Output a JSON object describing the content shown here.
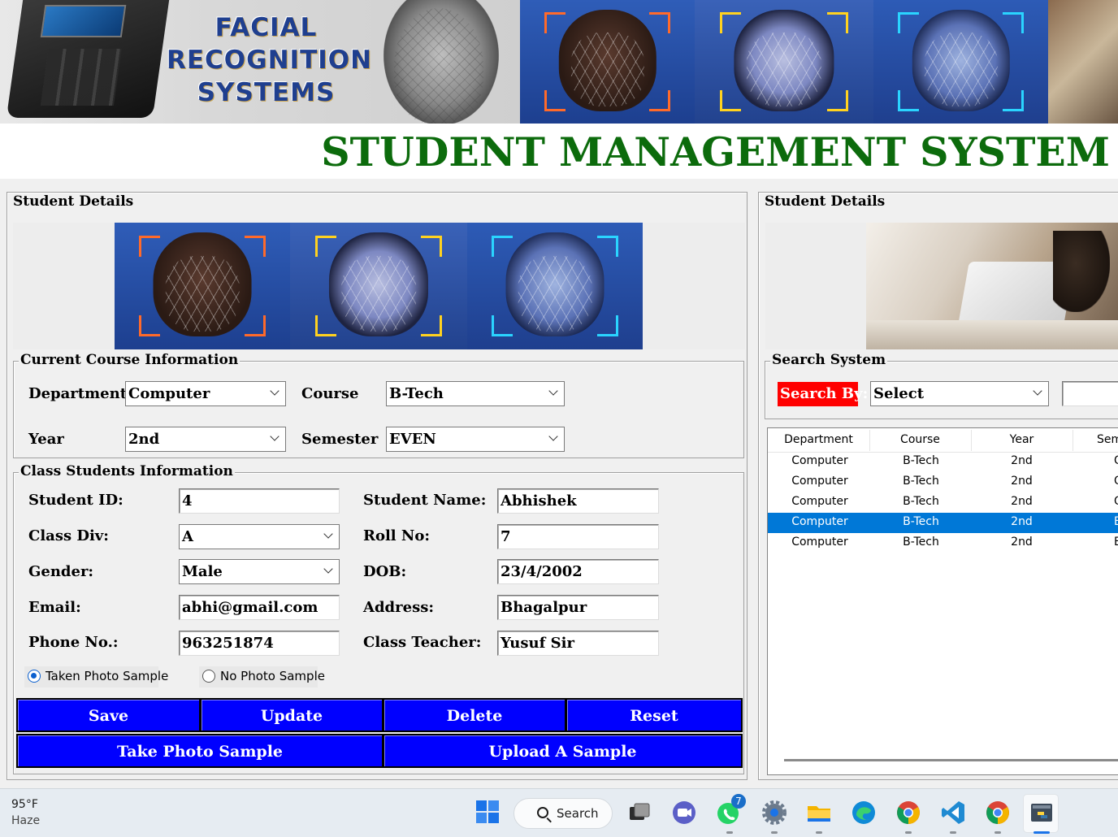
{
  "banner": {
    "text_lines": [
      "FACIAL",
      "RECOGNITION",
      "SYSTEMS"
    ],
    "title": "STUDENT MANAGEMENT SYSTEM",
    "title_color": "#0c6b0c"
  },
  "left_panel": {
    "legend": "Student Details",
    "course_frame": {
      "legend": "Current Course Information",
      "department_label": "Department",
      "department_value": "Computer",
      "course_label": "Course",
      "course_value": "B-Tech",
      "year_label": "Year",
      "year_value": "2nd",
      "semester_label": "Semester",
      "semester_value": "EVEN"
    },
    "class_frame": {
      "legend": "Class Students Information",
      "student_id_label": "Student ID:",
      "student_id_value": "4",
      "student_name_label": "Student Name:",
      "student_name_value": "Abhishek",
      "class_div_label": "Class Div:",
      "class_div_value": "A",
      "roll_no_label": "Roll No:",
      "roll_no_value": "7",
      "gender_label": "Gender:",
      "gender_value": "Male",
      "dob_label": "DOB:",
      "dob_value": "23/4/2002",
      "email_label": "Email:",
      "email_value": "abhi@gmail.com",
      "address_label": "Address:",
      "address_value": "Bhagalpur",
      "phone_label": "Phone No.:",
      "phone_value": "963251874",
      "teacher_label": "Class Teacher:",
      "teacher_value": "Yusuf Sir",
      "radio_taken": "Taken Photo Sample",
      "radio_none": "No Photo Sample",
      "radio_selected": "Taken Photo Sample"
    },
    "buttons": {
      "save": "Save",
      "update": "Update",
      "delete": "Delete",
      "reset": "Reset",
      "take_photo": "Take Photo Sample",
      "upload": "Upload A Sample",
      "color": "#0000ff"
    }
  },
  "right_panel": {
    "legend": "Student Details",
    "search_frame": {
      "legend": "Search System",
      "search_by_label": "Search By:",
      "search_by_value": "Select",
      "label_color": "#ff0000"
    },
    "table": {
      "columns": [
        "Department",
        "Course",
        "Year",
        "Sem"
      ],
      "rows": [
        [
          "Computer",
          "B-Tech",
          "2nd",
          "O"
        ],
        [
          "Computer",
          "B-Tech",
          "2nd",
          "O"
        ],
        [
          "Computer",
          "B-Tech",
          "2nd",
          "O"
        ],
        [
          "Computer",
          "B-Tech",
          "2nd",
          "E"
        ],
        [
          "Computer",
          "B-Tech",
          "2nd",
          "E"
        ]
      ],
      "selected_row": 3,
      "selection_color": "#0078d7"
    }
  },
  "taskbar": {
    "temperature": "95°F",
    "condition": "Haze",
    "search_label": "Search",
    "whatsapp_badge": "7",
    "icons": [
      "windows-start-icon",
      "task-view-icon",
      "teams-meet-icon",
      "whatsapp-icon",
      "settings-icon",
      "file-explorer-icon",
      "edge-icon",
      "chrome-icon",
      "vscode-icon",
      "chrome-icon",
      "python-app-icon"
    ]
  }
}
